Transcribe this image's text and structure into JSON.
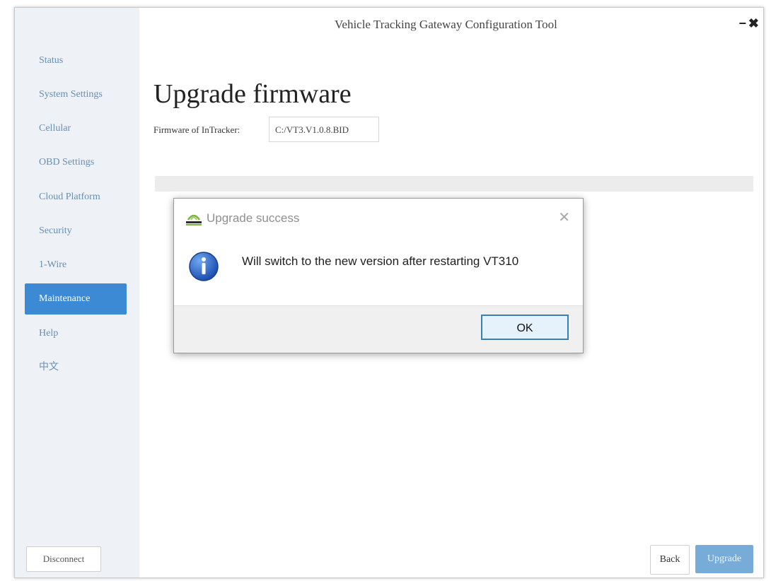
{
  "window": {
    "title": "Vehicle Tracking Gateway Configuration Tool",
    "minimize": "−",
    "close": "✖"
  },
  "sidebar": {
    "items": [
      {
        "label": "Status"
      },
      {
        "label": "System Settings"
      },
      {
        "label": "Cellular"
      },
      {
        "label": "OBD Settings"
      },
      {
        "label": "Cloud Platform"
      },
      {
        "label": "Security"
      },
      {
        "label": "1-Wire"
      },
      {
        "label": "Maintenance",
        "active": true
      },
      {
        "label": "Help"
      },
      {
        "label": "中文"
      }
    ],
    "disconnect_label": "Disconnect"
  },
  "main": {
    "title": "Upgrade firmware",
    "firmware_label": "Firmware of InTracker:",
    "firmware_value": "C:/VT3.V1.0.8.BID",
    "progress": 0,
    "back_label": "Back",
    "upgrade_label": "Upgrade"
  },
  "dialog": {
    "title": "Upgrade success",
    "message": "Will switch to the new version after restarting VT310",
    "ok_label": "OK",
    "close_glyph": "✕"
  },
  "colors": {
    "accent": "#3b8ad3",
    "upgrade_disabled": "#78acd8",
    "sidebar_bg": "#eef1f5"
  }
}
